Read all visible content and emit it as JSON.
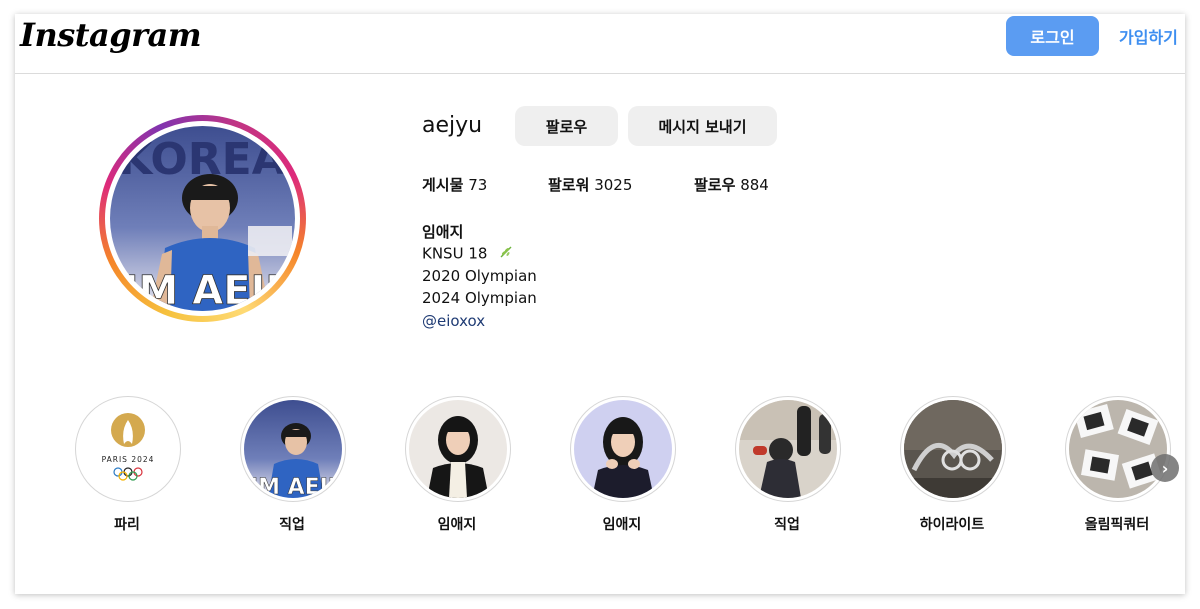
{
  "header": {
    "logo_text": "Instagram",
    "login_label": "로그인",
    "signup_label": "가입하기"
  },
  "profile": {
    "username": "aejyu",
    "follow_label": "팔로우",
    "message_label": "메시지 보내기",
    "stats": [
      {
        "label": "게시물",
        "value": "73"
      },
      {
        "label": "팔로워",
        "value": "3025"
      },
      {
        "label": "팔로우",
        "value": "884"
      }
    ],
    "full_name": "임애지",
    "bio_lines": [
      "KNSU 18",
      "2020 Olympian",
      "2024 Olympian"
    ],
    "bio_link": "@eioxox",
    "avatar_text_top": "KOREA",
    "avatar_text_bottom": "IM AEJI"
  },
  "highlights": [
    {
      "label": "파리"
    },
    {
      "label": "직업"
    },
    {
      "label": "임애지"
    },
    {
      "label": "임애지"
    },
    {
      "label": "직업"
    },
    {
      "label": "하이라이트"
    },
    {
      "label": "올림픽쿼터"
    }
  ],
  "paris_logo": {
    "text": "PARIS 2024"
  },
  "colors": {
    "accent": "#5b9cf2",
    "link": "#3d8ef0",
    "button_gray": "#efefef"
  }
}
